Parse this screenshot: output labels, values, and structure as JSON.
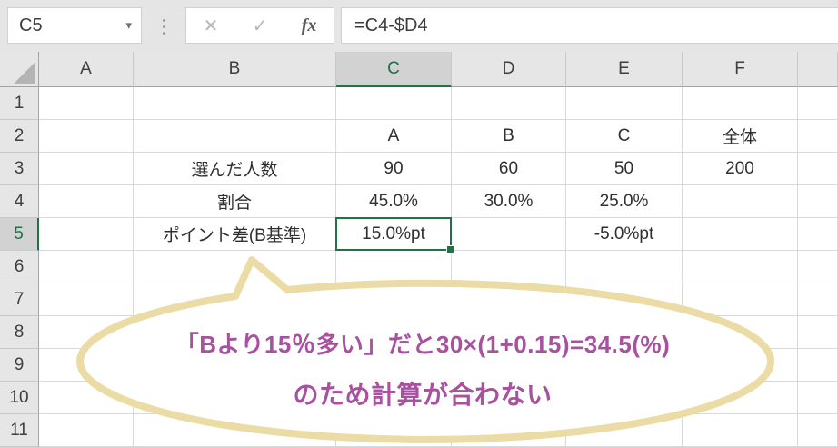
{
  "formula_bar": {
    "name_box_value": "C5",
    "dropdown_icon": "▾",
    "cancel_icon": "✕",
    "enter_icon": "✓",
    "insert_function_label": "fx",
    "formula": "=C4-$D4"
  },
  "grid": {
    "column_headers": [
      "A",
      "B",
      "C",
      "D",
      "E",
      "F"
    ],
    "row_headers": [
      "1",
      "2",
      "3",
      "4",
      "5",
      "6",
      "7",
      "8",
      "9",
      "10",
      "11"
    ],
    "selected_cell": "C5",
    "selected_column": "C",
    "selected_row": "5",
    "cells": {
      "C2": "A",
      "D2": "B",
      "E2": "C",
      "F2": "全体",
      "B3": "選んだ人数",
      "C3": "90",
      "D3": "60",
      "E3": "50",
      "F3": "200",
      "B4": "割合",
      "C4": "45.0%",
      "D4": "30.0%",
      "E4": "25.0%",
      "B5": "ポイント差(B基準)",
      "C5": "15.0%pt",
      "E5": "-5.0%pt"
    }
  },
  "callout": {
    "line1": "「Bより15％多い」だと30×(1+0.15)=34.5(%)",
    "line2": "のため計算が合わない"
  },
  "colors": {
    "accent_green": "#217346",
    "selected_header_text": "#1e7145",
    "header_bg": "#e6e6e6",
    "selected_header_bg": "#d2d2d2",
    "gridline": "#d9d9d9",
    "callout_border": "#ebdca5",
    "callout_text": "#a8519f"
  }
}
